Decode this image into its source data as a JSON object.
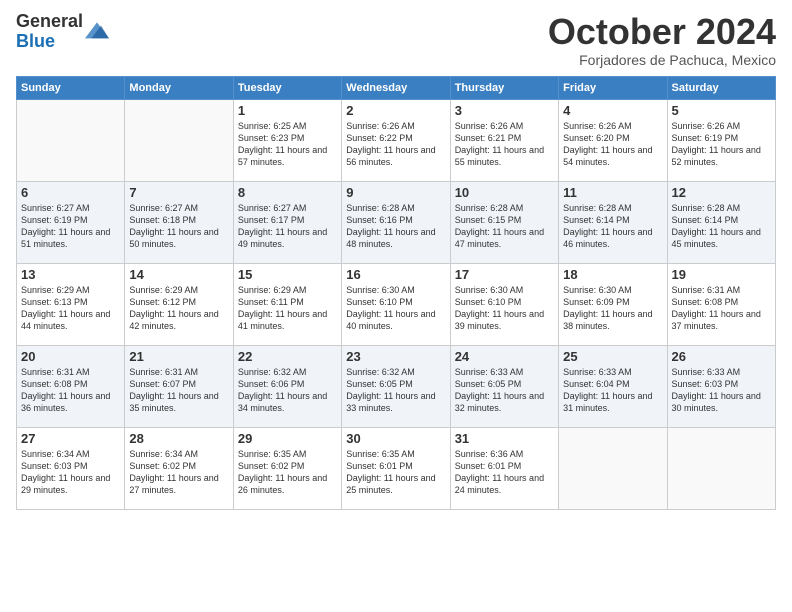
{
  "header": {
    "logo_general": "General",
    "logo_blue": "Blue",
    "month_title": "October 2024",
    "location": "Forjadores de Pachuca, Mexico"
  },
  "weekdays": [
    "Sunday",
    "Monday",
    "Tuesday",
    "Wednesday",
    "Thursday",
    "Friday",
    "Saturday"
  ],
  "weeks": [
    [
      {
        "day": "",
        "info": ""
      },
      {
        "day": "",
        "info": ""
      },
      {
        "day": "1",
        "info": "Sunrise: 6:25 AM\nSunset: 6:23 PM\nDaylight: 11 hours and 57 minutes."
      },
      {
        "day": "2",
        "info": "Sunrise: 6:26 AM\nSunset: 6:22 PM\nDaylight: 11 hours and 56 minutes."
      },
      {
        "day": "3",
        "info": "Sunrise: 6:26 AM\nSunset: 6:21 PM\nDaylight: 11 hours and 55 minutes."
      },
      {
        "day": "4",
        "info": "Sunrise: 6:26 AM\nSunset: 6:20 PM\nDaylight: 11 hours and 54 minutes."
      },
      {
        "day": "5",
        "info": "Sunrise: 6:26 AM\nSunset: 6:19 PM\nDaylight: 11 hours and 52 minutes."
      }
    ],
    [
      {
        "day": "6",
        "info": "Sunrise: 6:27 AM\nSunset: 6:19 PM\nDaylight: 11 hours and 51 minutes."
      },
      {
        "day": "7",
        "info": "Sunrise: 6:27 AM\nSunset: 6:18 PM\nDaylight: 11 hours and 50 minutes."
      },
      {
        "day": "8",
        "info": "Sunrise: 6:27 AM\nSunset: 6:17 PM\nDaylight: 11 hours and 49 minutes."
      },
      {
        "day": "9",
        "info": "Sunrise: 6:28 AM\nSunset: 6:16 PM\nDaylight: 11 hours and 48 minutes."
      },
      {
        "day": "10",
        "info": "Sunrise: 6:28 AM\nSunset: 6:15 PM\nDaylight: 11 hours and 47 minutes."
      },
      {
        "day": "11",
        "info": "Sunrise: 6:28 AM\nSunset: 6:14 PM\nDaylight: 11 hours and 46 minutes."
      },
      {
        "day": "12",
        "info": "Sunrise: 6:28 AM\nSunset: 6:14 PM\nDaylight: 11 hours and 45 minutes."
      }
    ],
    [
      {
        "day": "13",
        "info": "Sunrise: 6:29 AM\nSunset: 6:13 PM\nDaylight: 11 hours and 44 minutes."
      },
      {
        "day": "14",
        "info": "Sunrise: 6:29 AM\nSunset: 6:12 PM\nDaylight: 11 hours and 42 minutes."
      },
      {
        "day": "15",
        "info": "Sunrise: 6:29 AM\nSunset: 6:11 PM\nDaylight: 11 hours and 41 minutes."
      },
      {
        "day": "16",
        "info": "Sunrise: 6:30 AM\nSunset: 6:10 PM\nDaylight: 11 hours and 40 minutes."
      },
      {
        "day": "17",
        "info": "Sunrise: 6:30 AM\nSunset: 6:10 PM\nDaylight: 11 hours and 39 minutes."
      },
      {
        "day": "18",
        "info": "Sunrise: 6:30 AM\nSunset: 6:09 PM\nDaylight: 11 hours and 38 minutes."
      },
      {
        "day": "19",
        "info": "Sunrise: 6:31 AM\nSunset: 6:08 PM\nDaylight: 11 hours and 37 minutes."
      }
    ],
    [
      {
        "day": "20",
        "info": "Sunrise: 6:31 AM\nSunset: 6:08 PM\nDaylight: 11 hours and 36 minutes."
      },
      {
        "day": "21",
        "info": "Sunrise: 6:31 AM\nSunset: 6:07 PM\nDaylight: 11 hours and 35 minutes."
      },
      {
        "day": "22",
        "info": "Sunrise: 6:32 AM\nSunset: 6:06 PM\nDaylight: 11 hours and 34 minutes."
      },
      {
        "day": "23",
        "info": "Sunrise: 6:32 AM\nSunset: 6:05 PM\nDaylight: 11 hours and 33 minutes."
      },
      {
        "day": "24",
        "info": "Sunrise: 6:33 AM\nSunset: 6:05 PM\nDaylight: 11 hours and 32 minutes."
      },
      {
        "day": "25",
        "info": "Sunrise: 6:33 AM\nSunset: 6:04 PM\nDaylight: 11 hours and 31 minutes."
      },
      {
        "day": "26",
        "info": "Sunrise: 6:33 AM\nSunset: 6:03 PM\nDaylight: 11 hours and 30 minutes."
      }
    ],
    [
      {
        "day": "27",
        "info": "Sunrise: 6:34 AM\nSunset: 6:03 PM\nDaylight: 11 hours and 29 minutes."
      },
      {
        "day": "28",
        "info": "Sunrise: 6:34 AM\nSunset: 6:02 PM\nDaylight: 11 hours and 27 minutes."
      },
      {
        "day": "29",
        "info": "Sunrise: 6:35 AM\nSunset: 6:02 PM\nDaylight: 11 hours and 26 minutes."
      },
      {
        "day": "30",
        "info": "Sunrise: 6:35 AM\nSunset: 6:01 PM\nDaylight: 11 hours and 25 minutes."
      },
      {
        "day": "31",
        "info": "Sunrise: 6:36 AM\nSunset: 6:01 PM\nDaylight: 11 hours and 24 minutes."
      },
      {
        "day": "",
        "info": ""
      },
      {
        "day": "",
        "info": ""
      }
    ]
  ]
}
